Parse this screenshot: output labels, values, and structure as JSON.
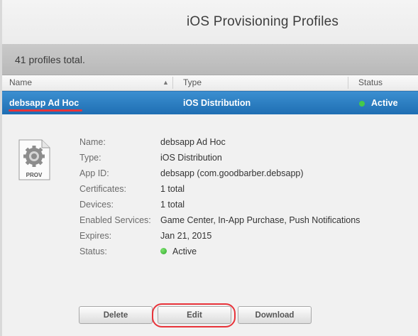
{
  "header": {
    "title": "iOS Provisioning Profiles"
  },
  "summary": {
    "text": "41 profiles total."
  },
  "columns": {
    "name": "Name",
    "type": "Type",
    "status": "Status"
  },
  "selected_row": {
    "name": "debsapp Ad Hoc",
    "type": "iOS Distribution",
    "status": "Active"
  },
  "details": {
    "icon_label": "PROV",
    "fields": [
      {
        "label": "Name:",
        "value": "debsapp Ad Hoc"
      },
      {
        "label": "Type:",
        "value": "iOS Distribution"
      },
      {
        "label": "App ID:",
        "value": "debsapp (com.goodbarber.debsapp)"
      },
      {
        "label": "Certificates:",
        "value": "1 total"
      },
      {
        "label": "Devices:",
        "value": "1 total"
      },
      {
        "label": "Enabled Services:",
        "value": "Game Center, In-App Purchase, Push Notifications"
      },
      {
        "label": "Expires:",
        "value": "Jan 21, 2015"
      },
      {
        "label": "Status:",
        "value": "Active"
      }
    ]
  },
  "actions": {
    "delete": "Delete",
    "edit": "Edit",
    "download": "Download"
  },
  "colors": {
    "selection": "#2a7cc2",
    "active_status": "#3bbf3a",
    "highlight": "#e8333a"
  }
}
